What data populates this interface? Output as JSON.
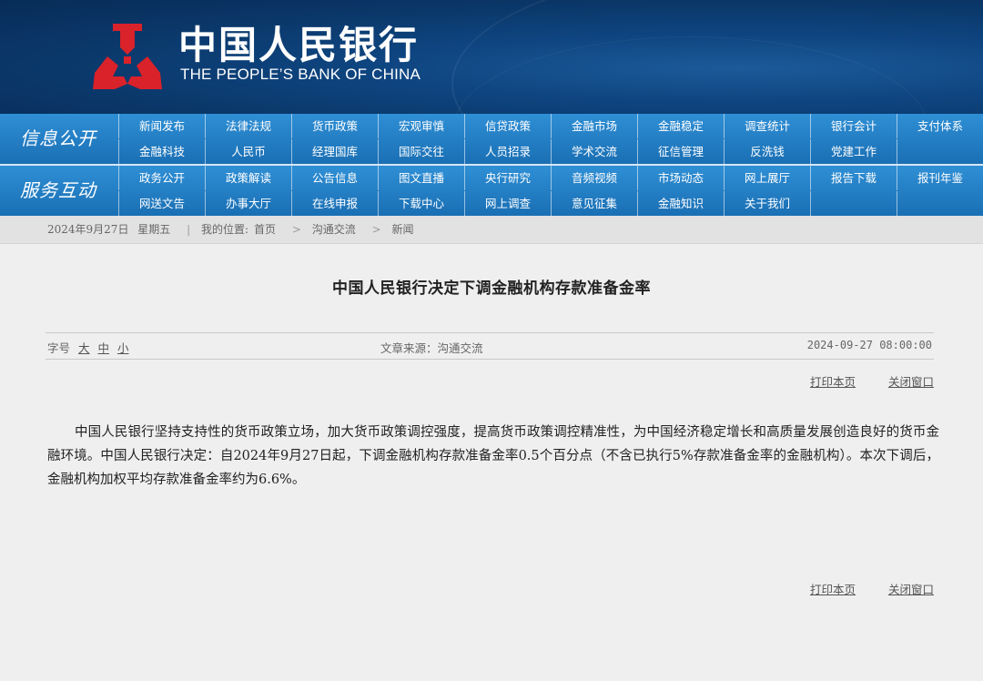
{
  "header": {
    "bank_name_cn": "中国人民银行",
    "bank_name_en": "THE PEOPLE’S BANK OF CHINA",
    "logo_icon": "pboc-emblem-icon",
    "logo_color": "#d9222a"
  },
  "nav": {
    "section1_label": "信息公开",
    "section1_items": [
      "新闻发布",
      "法律法规",
      "货币政策",
      "宏观审慎",
      "信贷政策",
      "金融市场",
      "金融稳定",
      "调查统计",
      "银行会计",
      "支付体系",
      "金融科技",
      "人民币",
      "经理国库",
      "国际交往",
      "人员招录",
      "学术交流",
      "征信管理",
      "反洗钱",
      "党建工作",
      ""
    ],
    "section2_label": "服务互动",
    "section2_items": [
      "政务公开",
      "政策解读",
      "公告信息",
      "图文直播",
      "央行研究",
      "音频视频",
      "市场动态",
      "网上展厅",
      "报告下载",
      "报刊年鉴",
      "网送文告",
      "办事大厅",
      "在线申报",
      "下载中心",
      "网上调查",
      "意见征集",
      "金融知识",
      "关于我们",
      "",
      ""
    ]
  },
  "breadcrumb": {
    "date": "2024年9月27日",
    "weekday": "星期五",
    "location_label": "我的位置:",
    "items": [
      "首页",
      "沟通交流",
      "新闻"
    ]
  },
  "article": {
    "title": "中国人民银行决定下调金融机构存款准备金率",
    "font_size_label": "字号",
    "font_large": "大",
    "font_medium": "中",
    "font_small": "小",
    "source": "文章来源：沟通交流",
    "datetime": "2024-09-27 08:00:00",
    "print_label": "打印本页",
    "close_label": "关闭窗口",
    "body": "中国人民银行坚持支持性的货币政策立场，加大货币政策调控强度，提高货币政策调控精准性，为中国经济稳定增长和高质量发展创造良好的货币金融环境。中国人民银行决定：自2024年9月27日起，下调金融机构存款准备金率0.5个百分点（不含已执行5%存款准备金率的金融机构）。本次下调后，金融机构加权平均存款准备金率约为6.6%。"
  }
}
